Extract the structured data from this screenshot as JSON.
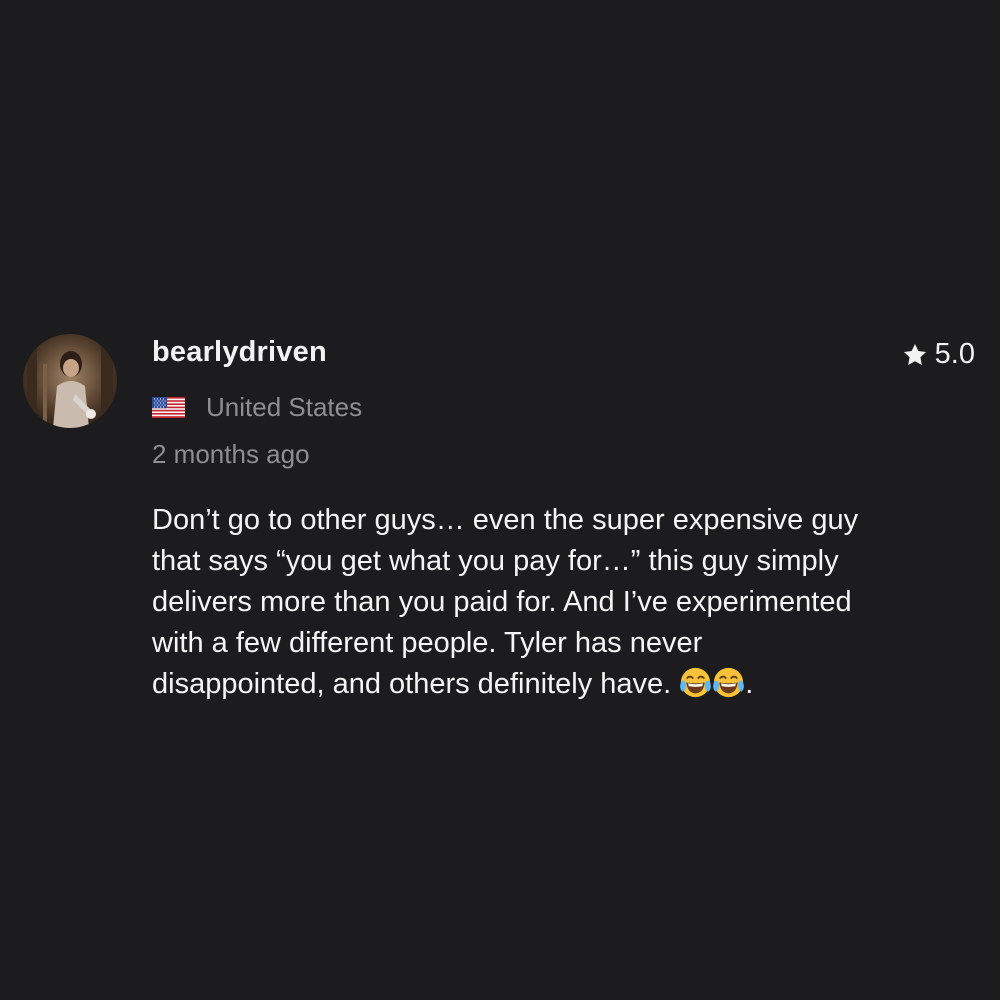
{
  "review": {
    "username": "bearlydriven",
    "rating": "5.0",
    "country": "United States",
    "country_flag_icon": "us-flag-icon",
    "time_ago": "2 months ago",
    "body_lines": [
      "Don’t go to other guys… even the super expensive guy",
      "that says “you get what you pay for…” this guy simply",
      "delivers more than you paid for. And I’ve experimented",
      "with a few different people. Tyler has never",
      "disappointed, and others definitely have."
    ],
    "body_trailing": ".",
    "emoji_icons": [
      "face-with-tears-of-joy-icon",
      "face-with-tears-of-joy-icon"
    ]
  },
  "colors": {
    "background": "#1c1c1e",
    "primary_text": "#f2f2f2",
    "secondary_text": "#8e8e93"
  }
}
